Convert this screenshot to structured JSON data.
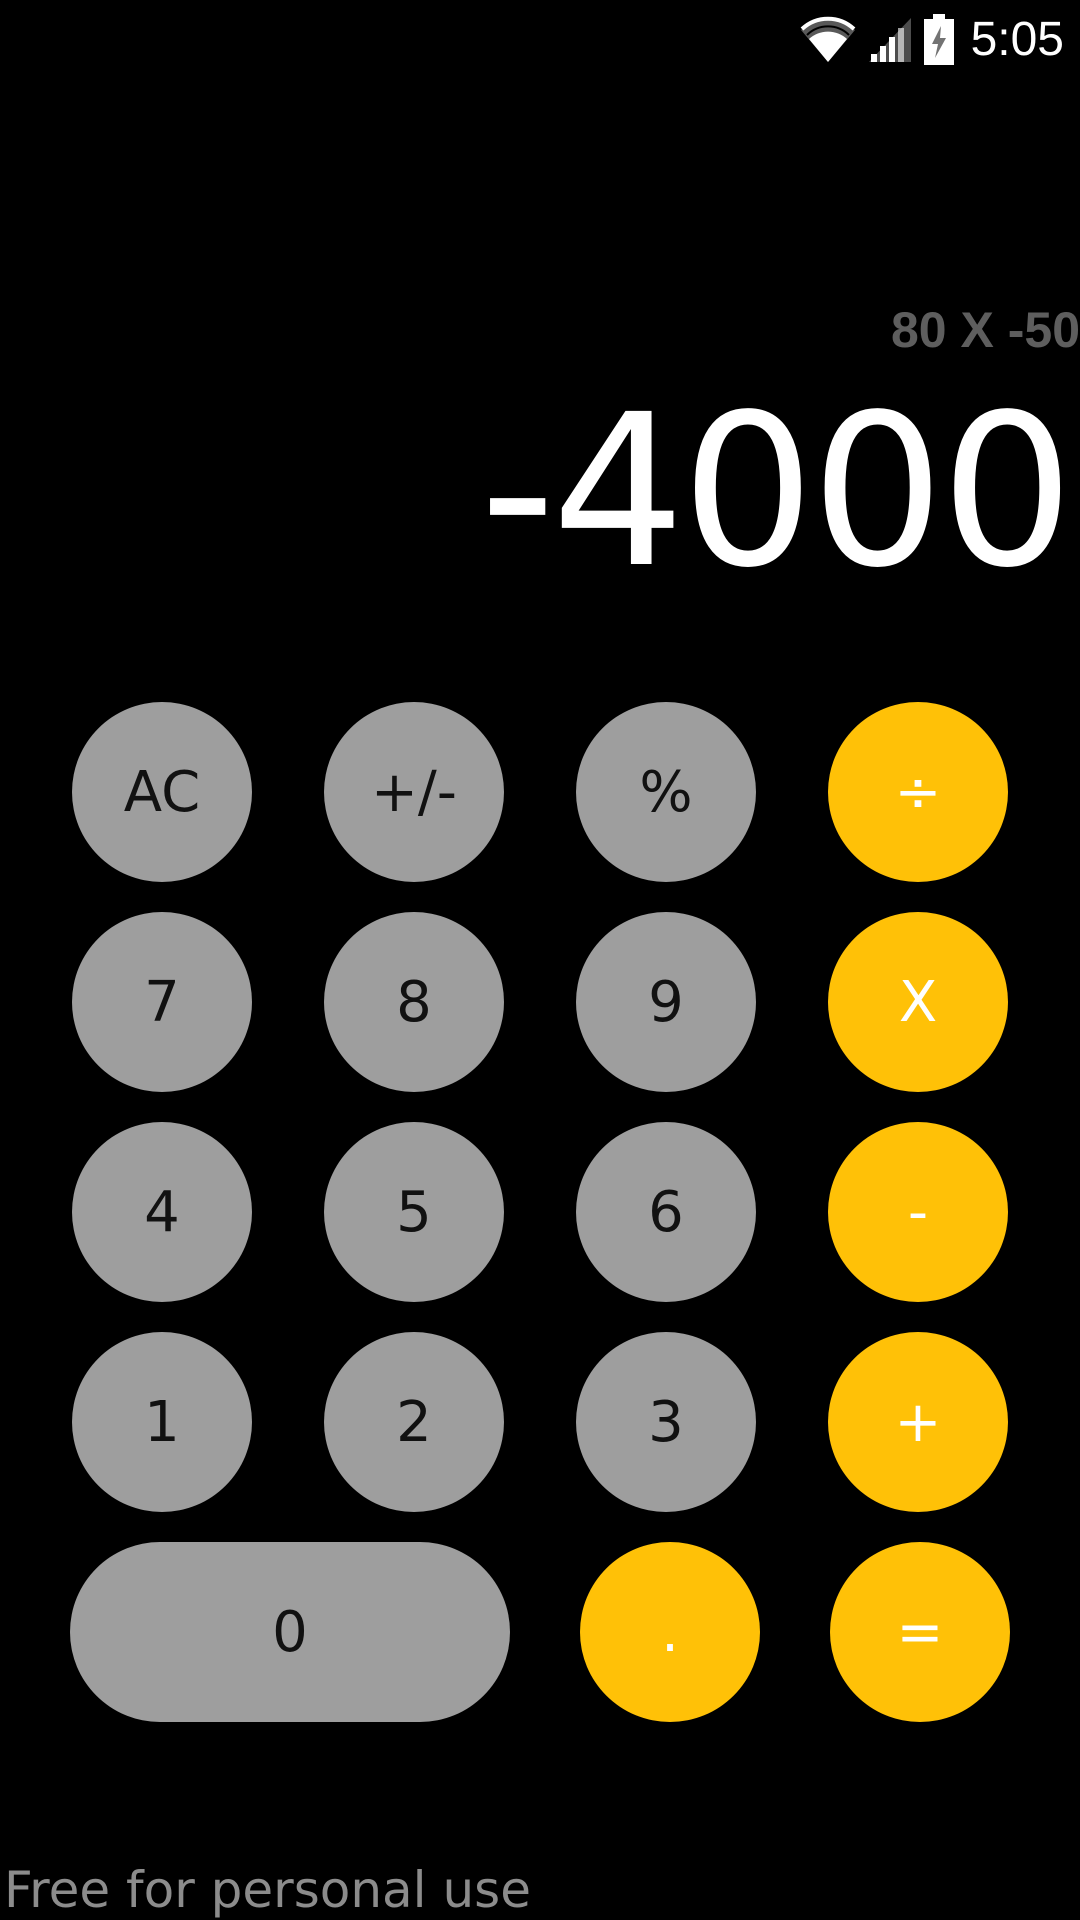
{
  "status_bar": {
    "time": "5:05",
    "icons": [
      "wifi-icon",
      "cellular-signal-icon",
      "battery-charging-icon"
    ]
  },
  "display": {
    "expression": "80 X -50",
    "result": "-4000"
  },
  "keypad": {
    "ac": "AC",
    "sign": "+/-",
    "percent": "%",
    "divide": "÷",
    "seven": "7",
    "eight": "8",
    "nine": "9",
    "multiply": "X",
    "four": "4",
    "five": "5",
    "six": "6",
    "minus": "-",
    "one": "1",
    "two": "2",
    "three": "3",
    "plus": "+",
    "zero": "0",
    "decimal": ".",
    "equals": "="
  },
  "footer": {
    "text": "Free for personal use"
  },
  "colors": {
    "background": "#000000",
    "function_key": "#9e9e9e",
    "operator_key": "#ffc107",
    "expression_text": "#5e5e5e",
    "result_text": "#ffffff"
  }
}
